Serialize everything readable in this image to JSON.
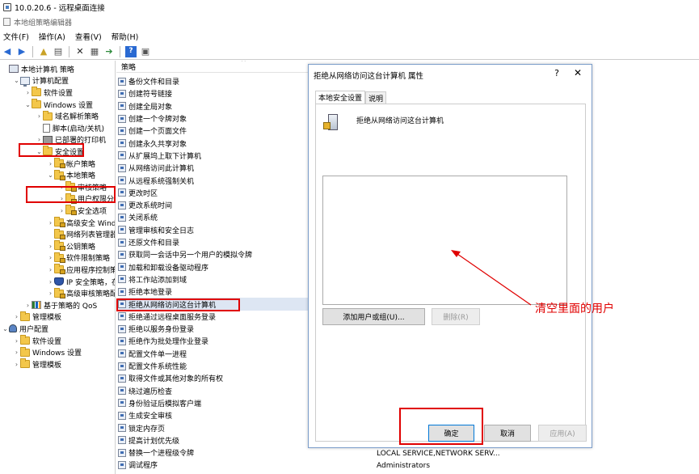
{
  "rdp_title": "10.0.20.6 - 远程桌面连接",
  "app_title": "本地组策略编辑器",
  "menu": [
    "文件(F)",
    "操作(A)",
    "查看(V)",
    "帮助(H)"
  ],
  "toolbar_icons": [
    "back-icon",
    "forward-icon",
    "up-icon",
    "show-tree-icon",
    "delete-icon",
    "properties-icon",
    "export-icon",
    "help-icon",
    "view-icon"
  ],
  "tree": [
    {
      "label": "本地计算机 策略",
      "icon": "policy",
      "indent": 0,
      "twisty": ""
    },
    {
      "label": "计算机配置",
      "icon": "pc",
      "indent": 1,
      "twisty": "v"
    },
    {
      "label": "软件设置",
      "icon": "folder",
      "indent": 2,
      "twisty": ">"
    },
    {
      "label": "Windows 设置",
      "icon": "folder",
      "indent": 2,
      "twisty": "v"
    },
    {
      "label": "域名解析策略",
      "icon": "folder",
      "indent": 3,
      "twisty": ">"
    },
    {
      "label": "脚本(启动/关机)",
      "icon": "doc",
      "indent": 3,
      "twisty": ""
    },
    {
      "label": "已部署的打印机",
      "icon": "printer",
      "indent": 3,
      "twisty": ">"
    },
    {
      "label": "安全设置",
      "icon": "folder",
      "indent": 3,
      "twisty": "v"
    },
    {
      "label": "帐户策略",
      "icon": "folder-lock",
      "indent": 4,
      "twisty": ">"
    },
    {
      "label": "本地策略",
      "icon": "folder-lock",
      "indent": 4,
      "twisty": "v"
    },
    {
      "label": "审核策略",
      "icon": "folder-lock",
      "indent": 5,
      "twisty": ">"
    },
    {
      "label": "用户权限分配",
      "icon": "folder-lock",
      "indent": 5,
      "twisty": ">"
    },
    {
      "label": "安全选项",
      "icon": "folder-lock",
      "indent": 5,
      "twisty": ">"
    },
    {
      "label": "高级安全 Window",
      "icon": "folder-lock",
      "indent": 4,
      "twisty": ">"
    },
    {
      "label": "网络列表管理器策",
      "icon": "folder-lock",
      "indent": 4,
      "twisty": ""
    },
    {
      "label": "公钥策略",
      "icon": "folder-lock",
      "indent": 4,
      "twisty": ">"
    },
    {
      "label": "软件限制策略",
      "icon": "folder-lock",
      "indent": 4,
      "twisty": ">"
    },
    {
      "label": "应用程序控制策略",
      "icon": "folder-lock",
      "indent": 4,
      "twisty": ">"
    },
    {
      "label": "IP 安全策略，在 ;",
      "icon": "shield",
      "indent": 4,
      "twisty": ">"
    },
    {
      "label": "高级审核策略配置",
      "icon": "folder-lock",
      "indent": 4,
      "twisty": ">"
    },
    {
      "label": "基于策略的 QoS",
      "icon": "chart",
      "indent": 2,
      "twisty": ">"
    },
    {
      "label": "管理模板",
      "icon": "folder",
      "indent": 1,
      "twisty": ">"
    },
    {
      "label": "用户配置",
      "icon": "user",
      "indent": 0,
      "twisty": "v"
    },
    {
      "label": "软件设置",
      "icon": "folder",
      "indent": 1,
      "twisty": ">"
    },
    {
      "label": "Windows 设置",
      "icon": "folder",
      "indent": 1,
      "twisty": ">"
    },
    {
      "label": "管理模板",
      "icon": "folder",
      "indent": 1,
      "twisty": ">"
    }
  ],
  "list_header": "策略",
  "policies": [
    "备份文件和目录",
    "创建符号链接",
    "创建全局对象",
    "创建一个令牌对象",
    "创建一个页面文件",
    "创建永久共享对象",
    "从扩展坞上取下计算机",
    "从网络访问此计算机",
    "从远程系统强制关机",
    "更改时区",
    "更改系统时间",
    "关闭系统",
    "管理审核和安全日志",
    "还原文件和目录",
    "获取同一会话中另一个用户的模拟令牌",
    "加载和卸载设备驱动程序",
    "将工作站添加到域",
    "拒绝本地登录",
    "拒绝从网络访问这台计算机",
    "拒绝通过远程桌面服务登录",
    "拒绝以服务身份登录",
    "拒绝作为批处理作业登录",
    "配置文件单一进程",
    "配置文件系统性能",
    "取得文件或其他对象的所有权",
    "绕过遍历检查",
    "身份验证后模拟客户端",
    "生成安全审核",
    "锁定内存页",
    "提高计划优先级",
    "替换一个进程级令牌",
    "调试程序"
  ],
  "selected_policy_index": 18,
  "security_values": [
    "LOCAL SERVICE,NETWORK SERV...",
    "Administrators"
  ],
  "dialog": {
    "title": "拒绝从网络访问这台计算机 属性",
    "help": "?",
    "close": "✕",
    "tabs": [
      "本地安全设置",
      "说明"
    ],
    "policy_name": "拒绝从网络访问这台计算机",
    "users": [],
    "add_button": "添加用户或组(U)...",
    "remove_button": "删除(R)",
    "ok_button": "确定",
    "cancel_button": "取消",
    "apply_button": "应用(A)"
  },
  "annotation": "清空里面的用户",
  "accent_red": "#e00000"
}
